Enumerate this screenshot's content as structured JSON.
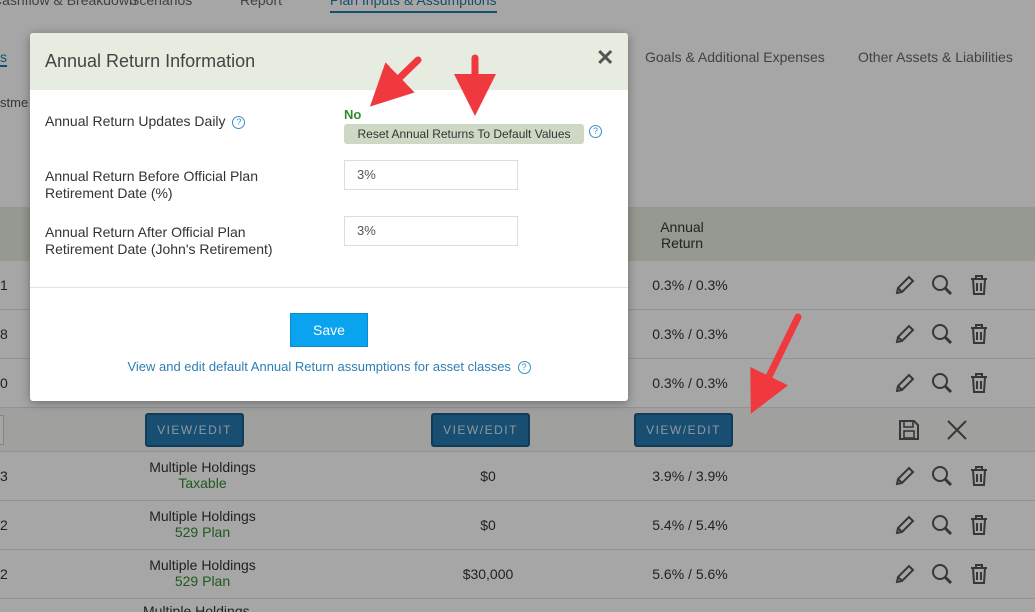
{
  "top_nav": {
    "items": [
      "Cashflow & Breakdown",
      "Scenarios",
      "Report",
      "Plan Inputs & Assumptions"
    ]
  },
  "sub_nav": {
    "items": [
      "Goals & Additional Expenses",
      "Other Assets & Liabilities"
    ],
    "partial_left": "s",
    "partial_text": "stme"
  },
  "table": {
    "annual_return_header_line1": "Annual",
    "annual_return_header_line2": "Return",
    "rows": [
      {
        "idx": "1",
        "holding": "",
        "sub": "",
        "amount": "",
        "ret": "0.3% / 0.3%"
      },
      {
        "idx": "8",
        "holding": "",
        "sub": "",
        "amount": "",
        "ret": "0.3% / 0.3%"
      },
      {
        "idx": "0",
        "holding": "",
        "sub": "",
        "amount": "",
        "ret": "0.3% / 0.3%"
      },
      {
        "idx": "3",
        "holding": "Multiple Holdings",
        "sub": "Taxable",
        "amount": "$0",
        "ret": "3.9% / 3.9%"
      },
      {
        "idx": "2",
        "holding": "Multiple Holdings",
        "sub": "529 Plan",
        "amount": "$0",
        "ret": "5.4% / 5.4%"
      },
      {
        "idx": "2",
        "holding": "Multiple Holdings",
        "sub": "529 Plan",
        "amount": "$30,000",
        "ret": "5.6% / 5.6%"
      }
    ],
    "view_edit_label": "VIEW/EDIT",
    "next_row_partial": "Multiple Holdings"
  },
  "modal": {
    "title": "Annual Return Information",
    "close_glyph": "✕",
    "updates_daily_label": "Annual Return Updates Daily",
    "updates_daily_value": "No",
    "reset_button_label": "Reset Annual Returns To Default Values",
    "before_label_line1": "Annual Return Before Official Plan",
    "before_label_line2": "Retirement Date (%)",
    "before_value": "3%",
    "after_label_line1": "Annual Return After Official Plan",
    "after_label_line2": "Retirement Date (John's Retirement)",
    "after_value": "3%",
    "save_label": "Save",
    "view_link_label": "View and edit default Annual Return assumptions for asset classes",
    "help_glyph": "?"
  },
  "colors": {
    "accent_blue": "#1f7ba8",
    "header_green": "#e6ecdf",
    "status_green": "#2e8b2e",
    "save_button": "#0aa3f0",
    "annotation_red": "#f0393e"
  },
  "icons": [
    "pencil-icon",
    "magnifier-icon",
    "trash-icon",
    "floppy-save-icon",
    "close-x-icon",
    "help-circle-icon"
  ]
}
